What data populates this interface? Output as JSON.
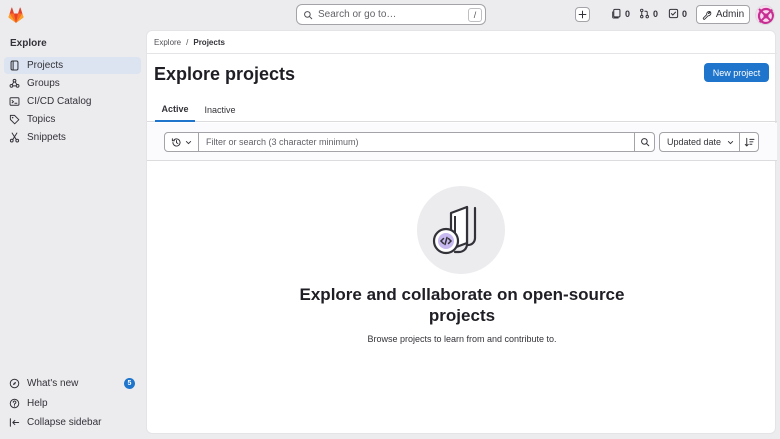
{
  "topbar": {
    "search_placeholder": "Search or go to…",
    "search_shortcut": "/",
    "issues_count": "0",
    "merge_requests_count": "0",
    "todos_count": "0",
    "admin_label": "Admin"
  },
  "sidebar": {
    "title": "Explore",
    "items": [
      {
        "label": "Projects",
        "icon": "project-icon",
        "active": true
      },
      {
        "label": "Groups",
        "icon": "group-icon"
      },
      {
        "label": "CI/CD Catalog",
        "icon": "catalog-icon"
      },
      {
        "label": "Topics",
        "icon": "label-icon"
      },
      {
        "label": "Snippets",
        "icon": "snippet-icon"
      }
    ],
    "footer": {
      "whats_new_label": "What's new",
      "whats_new_count": "5",
      "help_label": "Help",
      "collapse_label": "Collapse sidebar"
    }
  },
  "breadcrumb": {
    "root": "Explore",
    "separator": "/",
    "current": "Projects"
  },
  "main": {
    "title": "Explore projects",
    "new_project_label": "New project",
    "tabs": [
      {
        "label": "Active",
        "active": true
      },
      {
        "label": "Inactive"
      }
    ],
    "filter_placeholder": "Filter or search (3 character minimum)",
    "sort_label": "Updated date",
    "empty_title": "Explore and collaborate on open-source projects",
    "empty_description": "Browse projects to learn from and contribute to."
  },
  "colors": {
    "accent": "#1f75cb",
    "sidebar_active": "#dbe4f0",
    "logo": "#e24329"
  }
}
